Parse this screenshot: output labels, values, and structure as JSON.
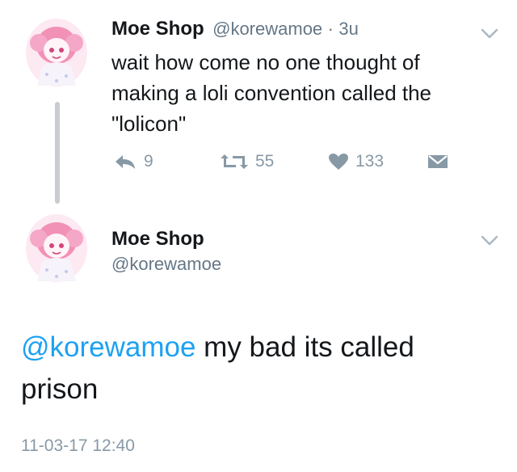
{
  "tweet": {
    "name": "Moe Shop",
    "handle": "@korewamoe",
    "separator": "·",
    "time": "3u",
    "text_lines": [
      "wait how come no one thought of",
      "making a loli convention called the",
      "\"lolicon\""
    ],
    "actions": {
      "reply_count": "9",
      "retweet_count": "55",
      "like_count": "133"
    }
  },
  "reply": {
    "name": "Moe Shop",
    "handle": "@korewamoe",
    "mention": "@korewamoe",
    "text_rest_line1": " my bad its called",
    "text_line2": "prison",
    "timestamp": "11-03-17 12:40"
  },
  "colors": {
    "accent": "#1da1f2",
    "muted": "#8899a6",
    "text": "#14171a",
    "thread_line": "#c8ccd0"
  }
}
